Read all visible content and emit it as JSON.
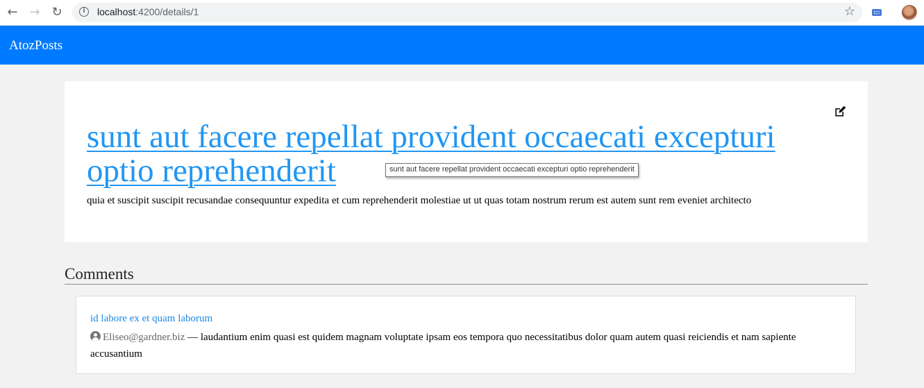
{
  "browser": {
    "url_host": "localhost",
    "url_path": ":4200/details/1",
    "icons": [
      "back-icon",
      "forward-icon",
      "reload-icon",
      "info-icon",
      "star-icon",
      "extension-icon",
      "profile-avatar"
    ]
  },
  "navbar": {
    "brand": "AtozPosts",
    "color": "#007bff"
  },
  "post": {
    "title": "sunt aut facere repellat provident occaecati excepturi optio reprehenderit",
    "body": "quia et suscipit suscipit recusandae consequuntur expedita et cum reprehenderit molestiae ut ut quas totam nostrum rerum est autem sunt rem eveniet architecto",
    "tooltip": "sunt aut facere repellat provident occaecati excepturi optio reprehenderit",
    "edit_icon": "edit-icon",
    "title_color": "#2196f3"
  },
  "comments": {
    "heading": "Comments",
    "items": [
      {
        "title": "id labore ex et quam laborum",
        "email": "Eliseo@gardner.biz",
        "separator": " — ",
        "body": "laudantium enim quasi est quidem magnam voluptate ipsam eos tempora quo necessitatibus dolor quam autem quasi reiciendis et nam sapiente accusantium"
      }
    ]
  }
}
